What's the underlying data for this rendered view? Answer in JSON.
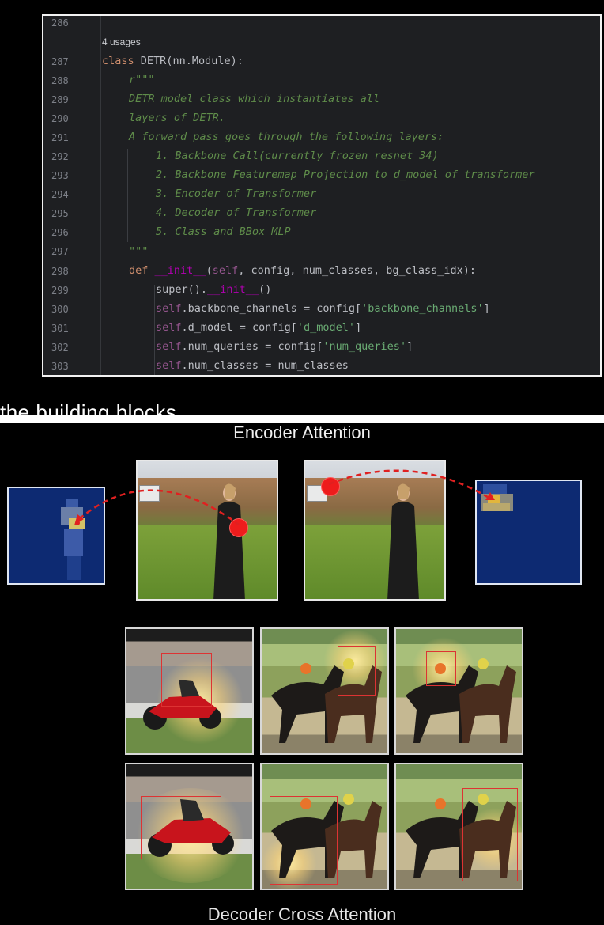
{
  "code": {
    "usages": "4 usages",
    "lines": [
      {
        "num": "286",
        "text": ""
      },
      {
        "num": "287",
        "text": "class DETR(nn.Module):"
      },
      {
        "num": "288",
        "text": "r\"\"\""
      },
      {
        "num": "289",
        "text": "DETR model class which instantiates all"
      },
      {
        "num": "290",
        "text": "layers of DETR."
      },
      {
        "num": "291",
        "text": "A forward pass goes through the following layers:"
      },
      {
        "num": "292",
        "text": "1. Backbone Call(currently frozen resnet 34)"
      },
      {
        "num": "293",
        "text": "2. Backbone Featuremap Projection to d_model of transformer"
      },
      {
        "num": "294",
        "text": "3. Encoder of Transformer"
      },
      {
        "num": "295",
        "text": "4. Decoder of Transformer"
      },
      {
        "num": "296",
        "text": "5. Class and BBox MLP"
      },
      {
        "num": "297",
        "text": "\"\"\""
      },
      {
        "num": "298",
        "text": "def __init__(self, config, num_classes, bg_class_idx):"
      },
      {
        "num": "299",
        "text": "super().__init__()"
      },
      {
        "num": "300",
        "text": "self.backbone_channels = config['backbone_channels']"
      },
      {
        "num": "301",
        "text": "self.d_model = config['d_model']"
      },
      {
        "num": "302",
        "text": "self.num_queries = config['num_queries']"
      },
      {
        "num": "303",
        "text": "self.num_classes = num_classes"
      }
    ]
  },
  "caption_fragment": "the building blocks",
  "figure": {
    "encoder_title": "Encoder Attention",
    "decoder_title": "Decoder Cross Attention"
  },
  "colors": {
    "code_bg": "#1e1f22",
    "keyword": "#cf8e6d",
    "docstring": "#5f8c4a",
    "string": "#6aab73",
    "self": "#94558d",
    "attention_dot": "#ee1c1c",
    "heatmap_bg": "#0d2a72"
  }
}
